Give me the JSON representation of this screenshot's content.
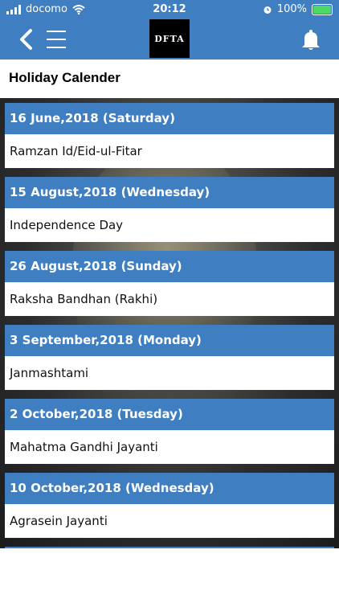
{
  "status": {
    "carrier": "docomo",
    "time": "20:12",
    "battery": "100%"
  },
  "appbar": {
    "logo_text": "DFTA"
  },
  "page": {
    "title": "Holiday Calender"
  },
  "holidays": [
    {
      "date": "16 June,2018 (Saturday)",
      "name": "Ramzan Id/Eid-ul-Fitar"
    },
    {
      "date": "15 August,2018 (Wednesday)",
      "name": "Independence Day"
    },
    {
      "date": "26 August,2018 (Sunday)",
      "name": "Raksha Bandhan (Rakhi)"
    },
    {
      "date": "3 September,2018 (Monday)",
      "name": "Janmashtami"
    },
    {
      "date": "2 October,2018 (Tuesday)",
      "name": "Mahatma Gandhi Jayanti"
    },
    {
      "date": "10 October,2018 (Wednesday)",
      "name": "Agrasein Jayanti"
    }
  ],
  "colors": {
    "primary": "#3f7fc1",
    "battery": "#4cd964"
  }
}
